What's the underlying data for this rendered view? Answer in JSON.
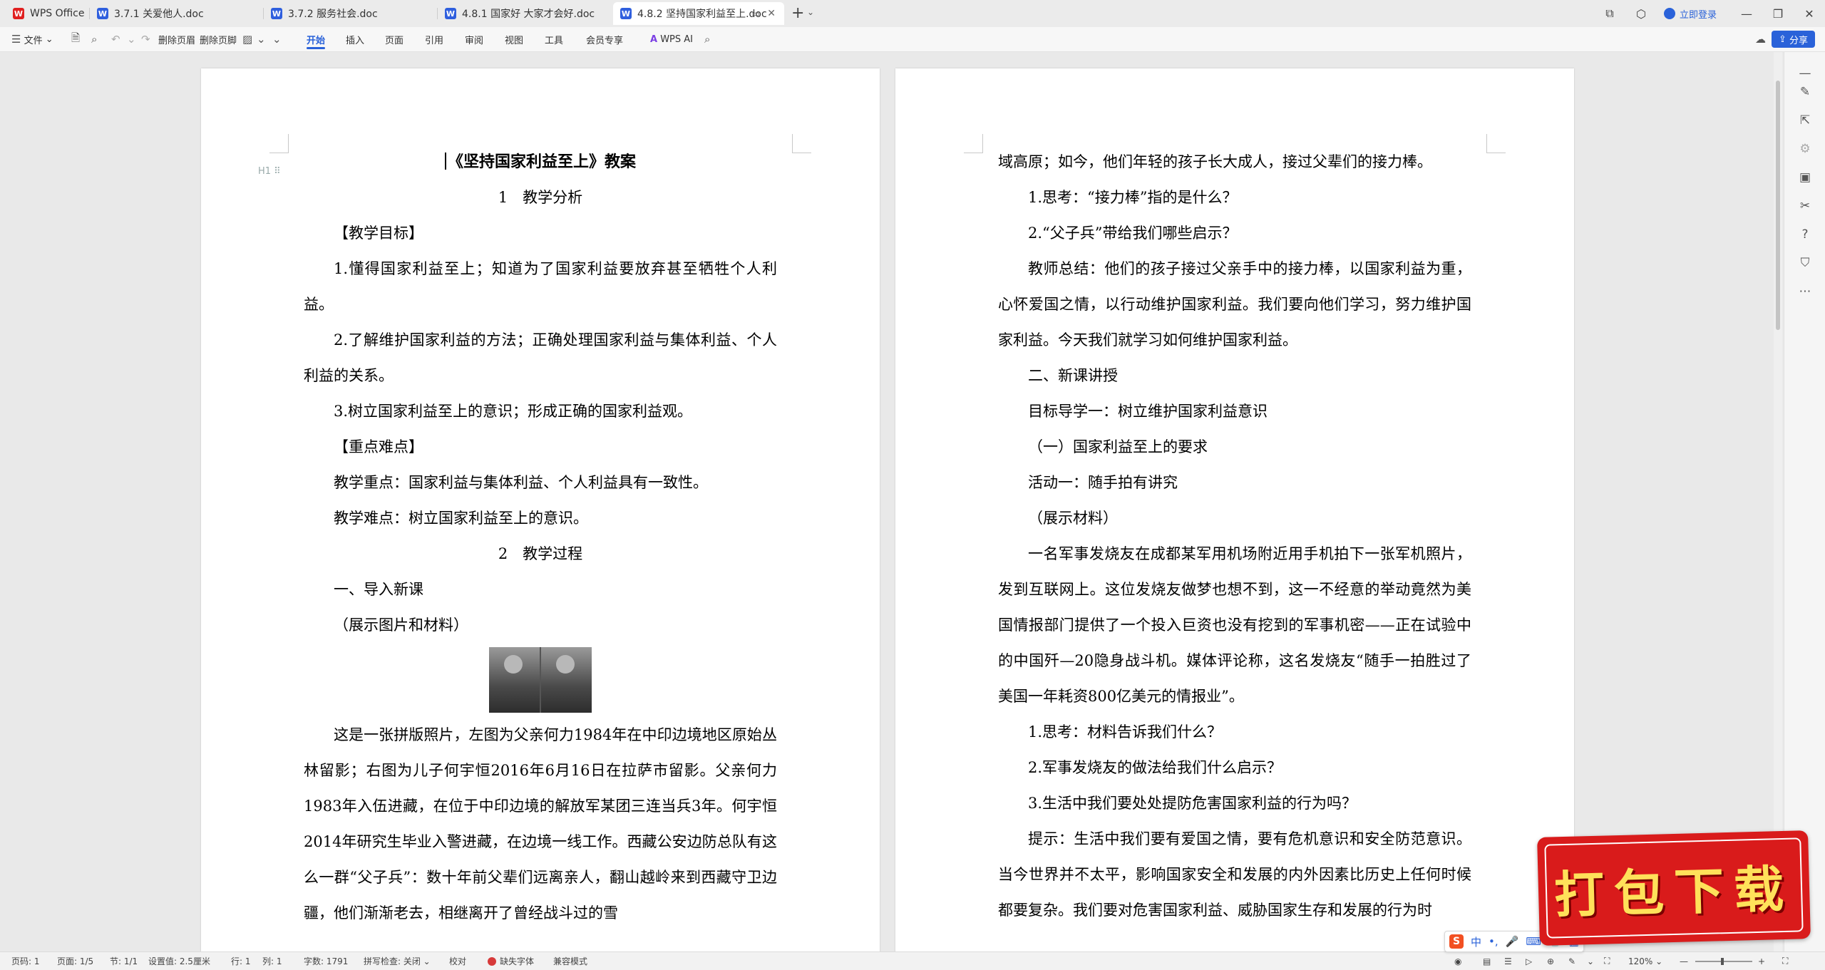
{
  "tabs": [
    {
      "label": "WPS Office",
      "icon": "wps-logo-icon"
    },
    {
      "label": "3.7.1 关爱他人.doc",
      "icon": "word-doc-icon"
    },
    {
      "label": "3.7.2 服务社会.doc",
      "icon": "word-doc-icon"
    },
    {
      "label": "4.8.1 国家好 大家才会好.doc",
      "icon": "word-doc-icon"
    },
    {
      "label": "4.8.2 坚持国家利益至上.doc",
      "icon": "word-doc-icon",
      "active": true
    }
  ],
  "titlebar": {
    "login": "立即登录"
  },
  "ribbon": {
    "file": "文件",
    "delete_header": "删除页眉",
    "delete_footer": "删除页脚",
    "tabs": [
      "开始",
      "插入",
      "页面",
      "引用",
      "审阅",
      "视图",
      "工具",
      "会员专享"
    ],
    "active_tab": "开始",
    "wps_ai": "WPS AI",
    "share": "分享"
  },
  "page1": {
    "heading_marker": "H1",
    "title": "《坚持国家利益至上》教案",
    "section1": "1　教学分析",
    "goal_label": "【教学目标】",
    "goal1": "1.懂得国家利益至上；知道为了国家利益要放弃甚至牺牲个人利益。",
    "goal2": "2.了解维护国家利益的方法；正确处理国家利益与集体利益、个人利益的关系。",
    "goal3": "3.树立国家利益至上的意识；形成正确的国家利益观。",
    "key_label": "【重点难点】",
    "key_point": "教学重点：国家利益与集体利益、个人利益具有一致性。",
    "hard_point": "教学难点：树立国家利益至上的意识。",
    "section2": "2　教学过程",
    "intro": "一、导入新课",
    "show_pics": "（展示图片和材料）",
    "para": "这是一张拼版照片，左图为父亲何力1984年在中印边境地区原始丛林留影；右图为儿子何宇恒2016年6月16日在拉萨市留影。父亲何力1983年入伍进藏，在位于中印边境的解放军某团三连当兵3年。何宇恒2014年研究生毕业入警进藏，在边境一线工作。西藏公安边防总队有这么一群“父子兵”：数十年前父辈们远离亲人，翻山越岭来到西藏守卫边疆，他们渐渐老去，相继离开了曾经战斗过的雪"
  },
  "page2": {
    "p0": "域高原；如今，他们年轻的孩子长大成人，接过父辈们的接力棒。",
    "q1": "1.思考：“接力棒”指的是什么？",
    "q2": "2.“父子兵”带给我们哪些启示？",
    "summary": "教师总结：他们的孩子接过父亲手中的接力棒，以国家利益为重，心怀爱国之情，以行动维护国家利益。我们要向他们学习，努力维护国家利益。今天我们就学习如何维护国家利益。",
    "new_lesson": "二、新课讲授",
    "target1": "目标导学一：树立维护国家利益意识",
    "sub1": "（一）国家利益至上的要求",
    "activity1": "活动一：随手拍有讲究",
    "show_material": "（展示材料）",
    "story": "一名军事发烧友在成都某军用机场附近用手机拍下一张军机照片，发到互联网上。这位发烧友做梦也想不到，这一不经意的举动竟然为美国情报部门提供了一个投入巨资也没有挖到的军事机密——正在试验中的中国歼—20隐身战斗机。媒体评论称，这名发烧友“随手一拍胜过了美国一年耗资800亿美元的情报业”。",
    "t1": "1.思考：材料告诉我们什么？",
    "t2": "2.军事发烧友的做法给我们什么启示？",
    "t3": "3.生活中我们要处处提防危害国家利益的行为吗？",
    "hint": "提示：生活中我们要有爱国之情，要有危机意识和安全防范意识。当今世界并不太平，影响国家安全和发展的内外因素比历史上任何时候都要复杂。我们要对危害国家利益、威胁国家生存和发展的行为时"
  },
  "status": {
    "page_no": "页码: 1",
    "pages": "页面: 1/5",
    "section": "节: 1/1",
    "setting": "设置值: 2.5厘米",
    "row": "行: 1",
    "col": "列: 1",
    "words": "字数: 1791",
    "spell": "拼写检查: 关闭",
    "proof": "校对",
    "missing_font": "缺失字体",
    "compat": "兼容模式",
    "zoom": "120%",
    "zoom_fraction": 0.45
  },
  "ime": {
    "label": "中"
  },
  "download_badge": "打包下载"
}
